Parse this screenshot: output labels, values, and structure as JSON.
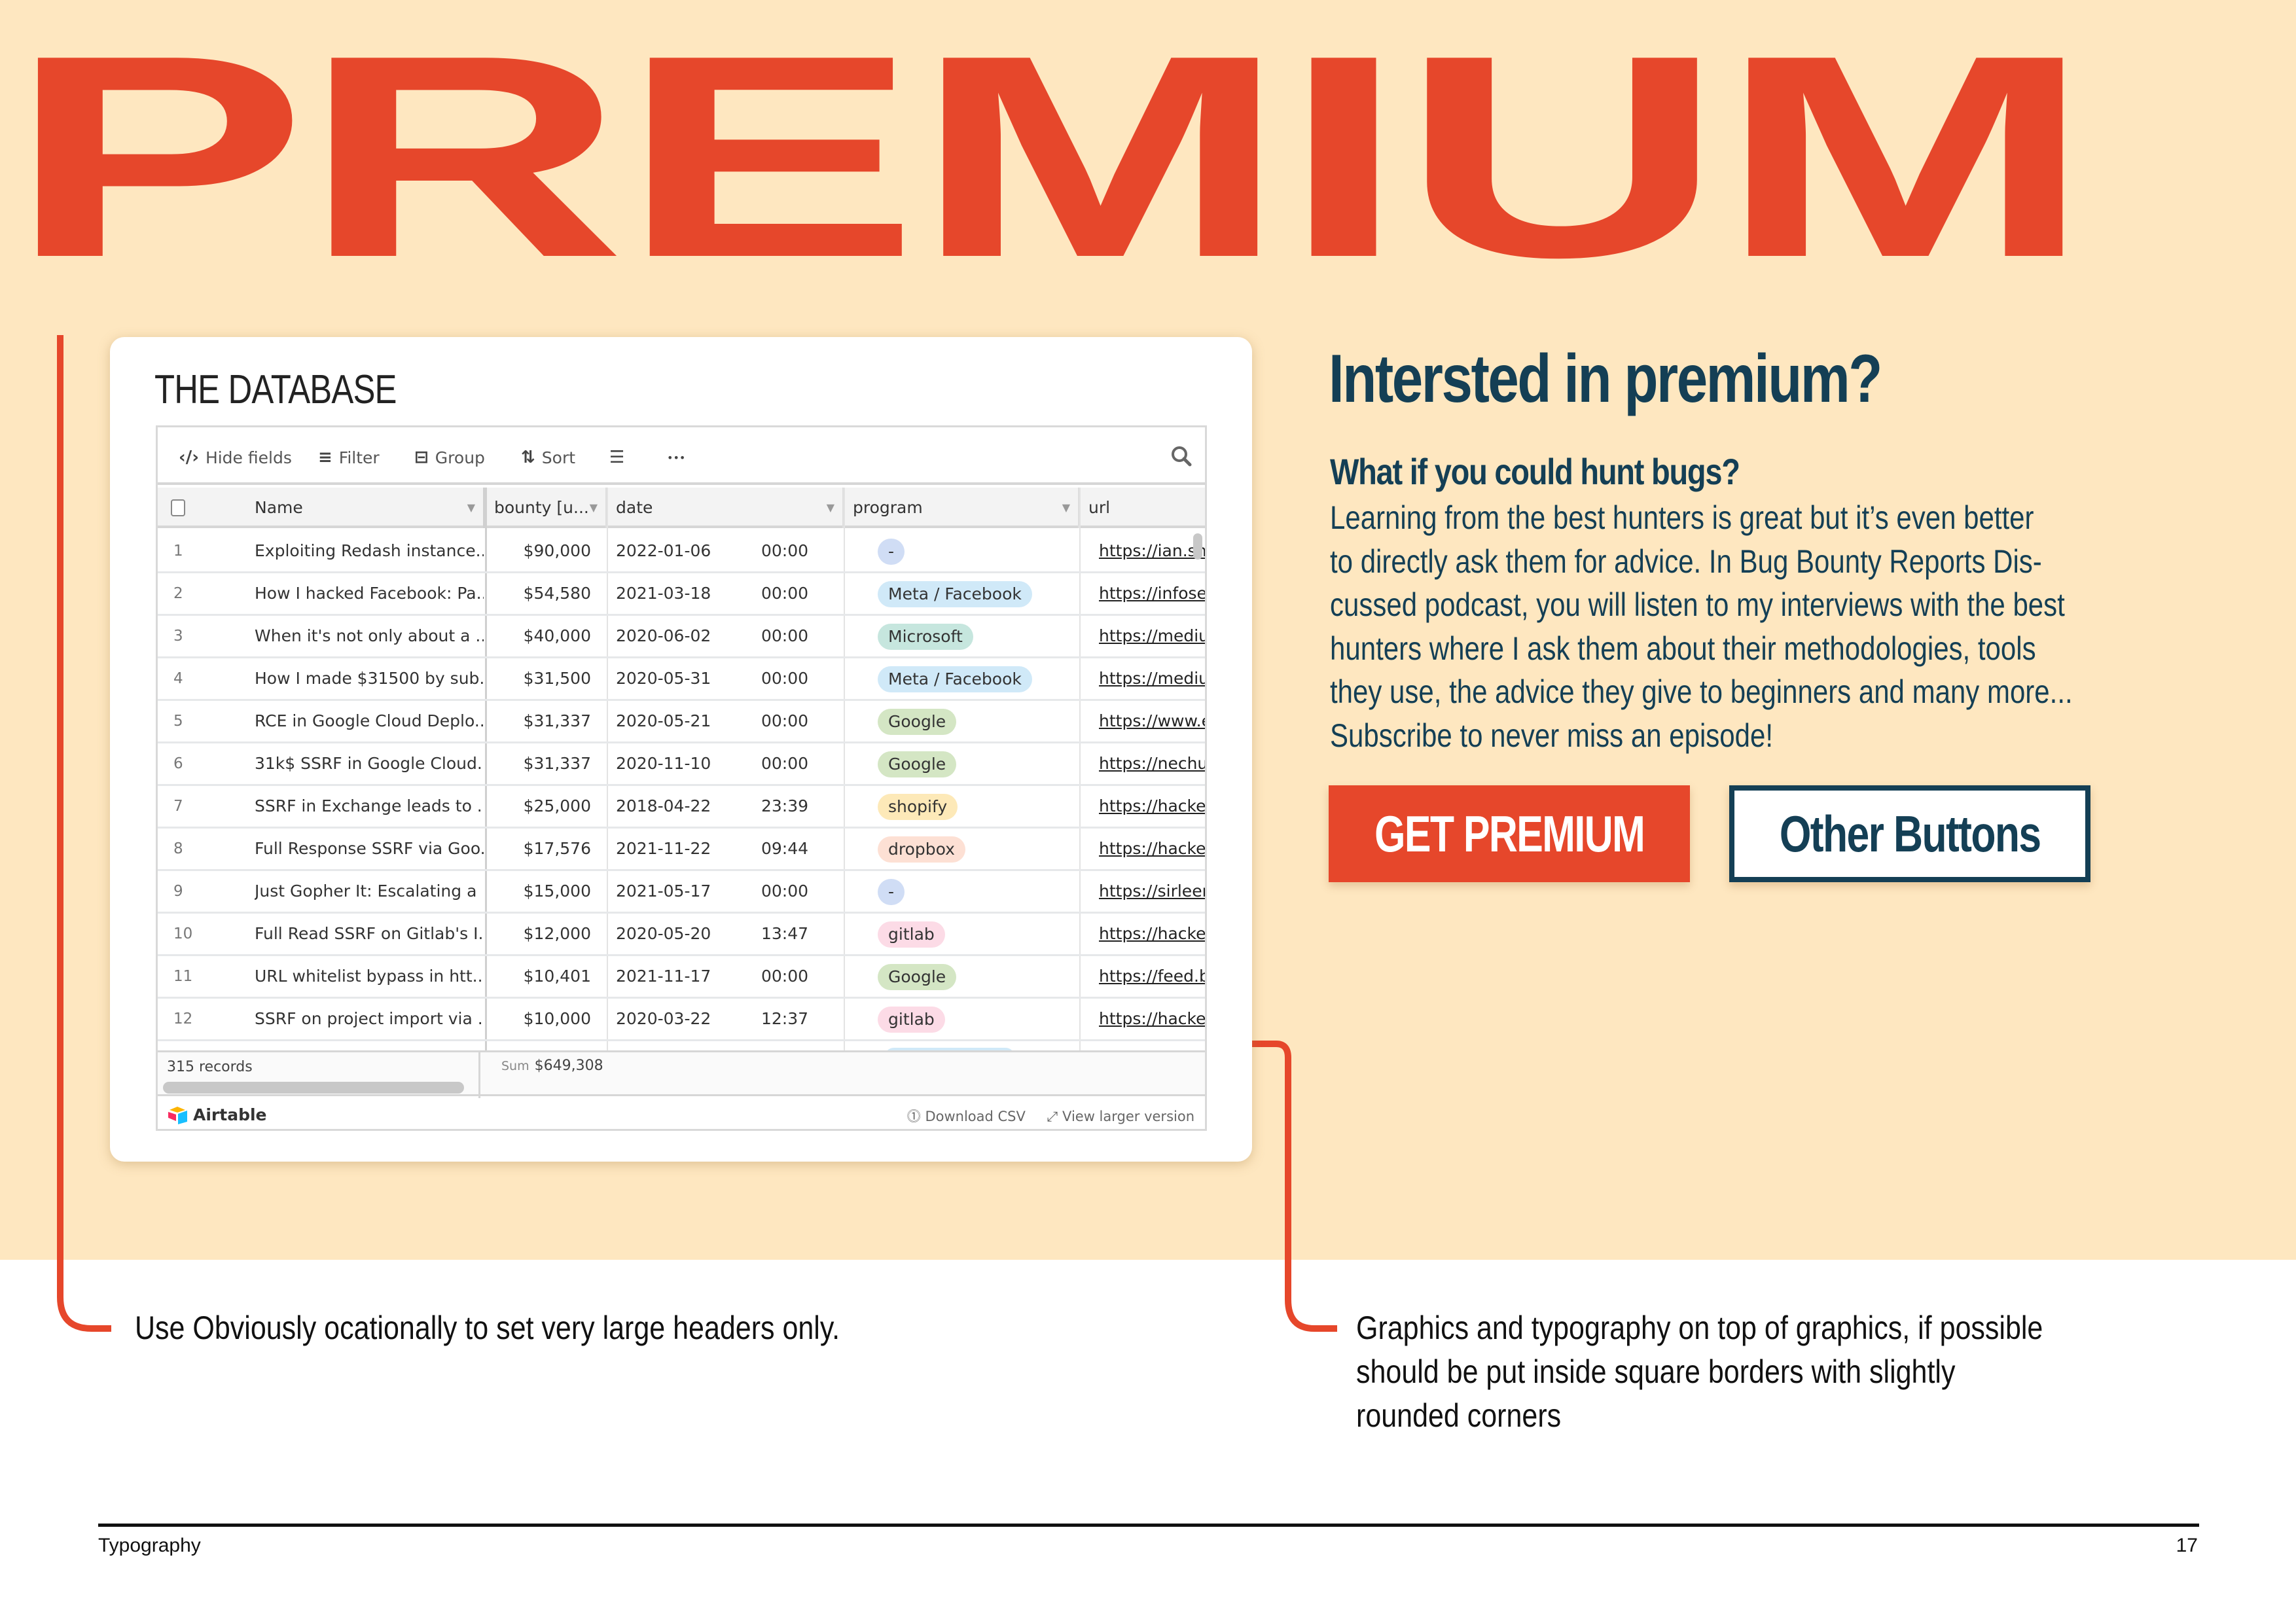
{
  "page": {
    "big_title": "PREMIUM",
    "colors": {
      "accent": "#e6472b",
      "background": "#fee7c0",
      "navy": "#143f55"
    }
  },
  "card": {
    "title": "THE DATABASE",
    "toolbar": {
      "hide_fields": "Hide fields",
      "filter": "Filter",
      "group": "Group",
      "sort": "Sort",
      "more": "•••"
    },
    "columns": [
      "Name",
      "bounty [u...",
      "date",
      "program",
      "url"
    ],
    "rows": [
      {
        "idx": "1",
        "name": "Exploiting Redash instance...",
        "bounty": "$90,000",
        "date": "2022-01-06",
        "time": "00:00",
        "program": "-",
        "program_color": "#d0ddf5",
        "url": "https://ian.sh/"
      },
      {
        "idx": "2",
        "name": "How I hacked Facebook: Pa...",
        "bounty": "$54,580",
        "date": "2021-03-18",
        "time": "00:00",
        "program": "Meta / Facebook",
        "program_color": "#d0e9f8",
        "url": "https://infosec"
      },
      {
        "idx": "3",
        "name": "When it's not only about a ...",
        "bounty": "$40,000",
        "date": "2020-06-02",
        "time": "00:00",
        "program": "Microsoft",
        "program_color": "#c6e6de",
        "url": "https://mediur"
      },
      {
        "idx": "4",
        "name": "How I made $31500 by sub...",
        "bounty": "$31,500",
        "date": "2020-05-31",
        "time": "00:00",
        "program": "Meta / Facebook",
        "program_color": "#d0e9f8",
        "url": "https://mediur"
      },
      {
        "idx": "5",
        "name": "RCE in Google Cloud Deplo...",
        "bounty": "$31,337",
        "date": "2020-05-21",
        "time": "00:00",
        "program": "Google",
        "program_color": "#d4e6c4",
        "url": "https://www.e:"
      },
      {
        "idx": "6",
        "name": "31k$ SSRF in Google Cloud...",
        "bounty": "$31,337",
        "date": "2020-11-10",
        "time": "00:00",
        "program": "Google",
        "program_color": "#d4e6c4",
        "url": "https://nechuc"
      },
      {
        "idx": "7",
        "name": "SSRF in Exchange leads to ...",
        "bounty": "$25,000",
        "date": "2018-04-22",
        "time": "23:39",
        "program": "shopify",
        "program_color": "#fde9b8",
        "url": "https://hacker"
      },
      {
        "idx": "8",
        "name": "Full Response SSRF via Goo...",
        "bounty": "$17,576",
        "date": "2021-11-22",
        "time": "09:44",
        "program": "dropbox",
        "program_color": "#fde0d4",
        "url": "https://hacker"
      },
      {
        "idx": "9",
        "name": "Just Gopher It: Escalating a ...",
        "bounty": "$15,000",
        "date": "2021-05-17",
        "time": "00:00",
        "program": "-",
        "program_color": "#d0ddf5",
        "url": "https://sirleerc"
      },
      {
        "idx": "10",
        "name": "Full Read SSRF on Gitlab's I...",
        "bounty": "$12,000",
        "date": "2020-05-20",
        "time": "13:47",
        "program": "gitlab",
        "program_color": "#fcdbe6",
        "url": "https://hacker"
      },
      {
        "idx": "11",
        "name": "URL whitelist bypass in htt...",
        "bounty": "$10,401",
        "date": "2021-11-17",
        "time": "00:00",
        "program": "Google",
        "program_color": "#d4e6c4",
        "url": "https://feed.bu"
      },
      {
        "idx": "12",
        "name": "SSRF on project import via ...",
        "bounty": "$10,000",
        "date": "2020-03-22",
        "time": "12:37",
        "program": "gitlab",
        "program_color": "#fcdbe6",
        "url": "https://hacker"
      }
    ],
    "records": "315 records",
    "sum_label": "Sum",
    "sum_value": "$649,308",
    "brand": "Airtable",
    "download_csv": "Download CSV",
    "view_larger": "View larger version"
  },
  "right": {
    "heading": "Intersted in premium?",
    "subheading": "What if you could hunt bugs?",
    "body_lines": [
      "Learning from the best hunters is great but it’s even better",
      "to directly ask them for advice. In Bug Bounty Reports Dis-",
      "cussed podcast, you will listen to my interviews with the best",
      "hunters where I ask them about their methodologies, tools",
      "they use, the advice they give to beginners and many more...",
      "Subscribe to never miss an episode!"
    ],
    "primary_button": "GET PREMIUM",
    "secondary_button": "Other Buttons"
  },
  "captions": {
    "left": "Use Obviously ocationally to set very large headers only.",
    "right_lines": [
      "Graphics and typography on top of graphics, if possible",
      "should be put inside square borders with slightly",
      "rounded corners"
    ]
  },
  "footer": {
    "section": "Typography",
    "page_number": "17"
  }
}
